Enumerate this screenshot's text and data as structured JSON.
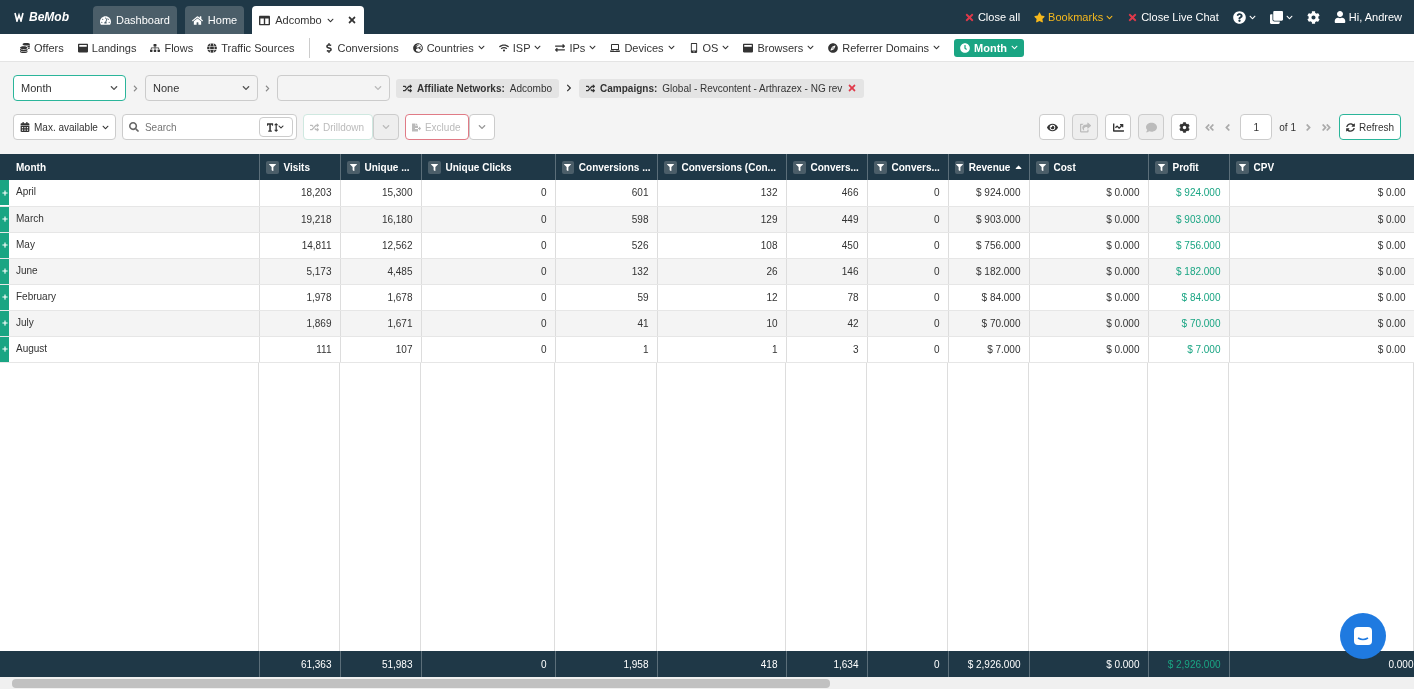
{
  "brand": "BeMob",
  "tabs": [
    {
      "label": "Dashboard",
      "selected": false
    },
    {
      "label": "Home",
      "selected": false
    },
    {
      "label": "Adcombo",
      "selected": true
    }
  ],
  "top_actions": {
    "close_all": "Close all",
    "bookmarks": "Bookmarks",
    "close_chat": "Close Live Chat",
    "user": "Hi, Andrew"
  },
  "nav": [
    {
      "label": "Offers",
      "dropdown": false
    },
    {
      "label": "Landings",
      "dropdown": false
    },
    {
      "label": "Flows",
      "dropdown": false
    },
    {
      "label": "Traffic Sources",
      "dropdown": false
    },
    {
      "label": "Conversions",
      "dropdown": false
    },
    {
      "label": "Countries",
      "dropdown": true
    },
    {
      "label": "ISP",
      "dropdown": true
    },
    {
      "label": "IPs",
      "dropdown": true
    },
    {
      "label": "Devices",
      "dropdown": true
    },
    {
      "label": "OS",
      "dropdown": true
    },
    {
      "label": "Browsers",
      "dropdown": true
    },
    {
      "label": "Referrer Domains",
      "dropdown": true
    },
    {
      "label": "Month",
      "dropdown": true,
      "selected": true
    }
  ],
  "grouping": [
    {
      "value": "Month",
      "focused": true
    },
    {
      "value": "None",
      "focused": false
    },
    {
      "focused": false
    }
  ],
  "breadcrumbs": [
    {
      "label": "Affiliate Networks:",
      "value": "Adcombo",
      "removable": false
    },
    {
      "label": "Campaigns:",
      "value": "Global - Revcontent - Arthrazex - NG rev",
      "removable": true
    }
  ],
  "toolbar": {
    "date_range": "Max. available",
    "search_placeholder": "Search",
    "drilldown": "Drilldown",
    "exclude": "Exclude",
    "page": "1",
    "page_of": "of 1",
    "refresh": "Refresh"
  },
  "columns": [
    {
      "label": "Month",
      "filter": false,
      "sorted": false
    },
    {
      "label": "Visits",
      "filter": true,
      "sorted": false
    },
    {
      "label": "Unique ...",
      "filter": true,
      "sorted": false
    },
    {
      "label": "Unique Clicks",
      "filter": true,
      "sorted": false
    },
    {
      "label": "Conversions ...",
      "filter": true,
      "sorted": false
    },
    {
      "label": "Conversions (Con...",
      "filter": true,
      "sorted": false
    },
    {
      "label": "Convers...",
      "filter": true,
      "sorted": false
    },
    {
      "label": "Convers...",
      "filter": true,
      "sorted": false
    },
    {
      "label": "Revenue",
      "filter": true,
      "sorted": true
    },
    {
      "label": "Cost",
      "filter": true,
      "sorted": false
    },
    {
      "label": "Profit",
      "filter": true,
      "sorted": false
    },
    {
      "label": "CPV",
      "filter": true,
      "sorted": false
    }
  ],
  "rows": [
    [
      "April",
      "18,203",
      "15,300",
      "0",
      "601",
      "132",
      "466",
      "0",
      "$ 924.000",
      "$ 0.000",
      "$ 924.000",
      "$ 0.00"
    ],
    [
      "March",
      "19,218",
      "16,180",
      "0",
      "598",
      "129",
      "449",
      "0",
      "$ 903.000",
      "$ 0.000",
      "$ 903.000",
      "$ 0.00"
    ],
    [
      "May",
      "14,811",
      "12,562",
      "0",
      "526",
      "108",
      "450",
      "0",
      "$ 756.000",
      "$ 0.000",
      "$ 756.000",
      "$ 0.00"
    ],
    [
      "June",
      "5,173",
      "4,485",
      "0",
      "132",
      "26",
      "146",
      "0",
      "$ 182.000",
      "$ 0.000",
      "$ 182.000",
      "$ 0.00"
    ],
    [
      "February",
      "1,978",
      "1,678",
      "0",
      "59",
      "12",
      "78",
      "0",
      "$ 84.000",
      "$ 0.000",
      "$ 84.000",
      "$ 0.00"
    ],
    [
      "July",
      "1,869",
      "1,671",
      "0",
      "41",
      "10",
      "42",
      "0",
      "$ 70.000",
      "$ 0.000",
      "$ 70.000",
      "$ 0.00"
    ],
    [
      "August",
      "111",
      "107",
      "0",
      "1",
      "1",
      "3",
      "0",
      "$ 7.000",
      "$ 0.000",
      "$ 7.000",
      "$ 0.00"
    ]
  ],
  "totals": [
    "61,363",
    "51,983",
    "0",
    "1,958",
    "418",
    "1,634",
    "0",
    "$ 2,926.000",
    "$ 0.000",
    "$ 2,926.000",
    "0.000"
  ]
}
